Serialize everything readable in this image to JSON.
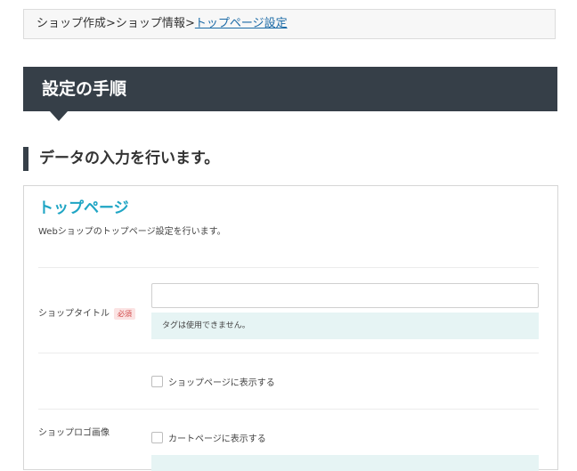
{
  "breadcrumb": {
    "item1": "ショップ作成",
    "sep1": ">",
    "item2": "ショップ情報",
    "sep2": ">",
    "current": "トップページ設定"
  },
  "section": {
    "title": "設定の手順"
  },
  "step": {
    "heading": "データの入力を行います。"
  },
  "panel": {
    "title": "トップページ",
    "description": "Webショップのトップページ設定を行います。",
    "shop_title": {
      "label": "ショップタイトル",
      "badge": "必須",
      "value": "",
      "note": "タグは使用できません。"
    },
    "shop_logo": {
      "label": "ショップロゴ画像",
      "option1": "ショップページに表示する",
      "option2": "カートページに表示する"
    }
  }
}
